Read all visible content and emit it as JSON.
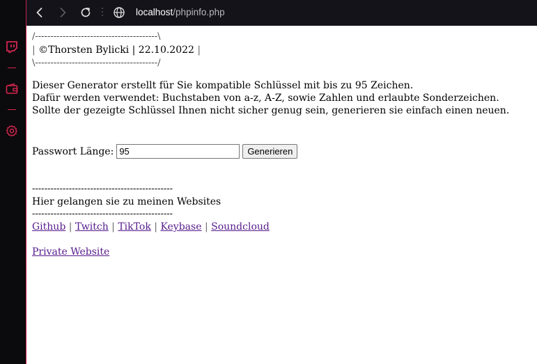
{
  "browser": {
    "url_host": "localhost",
    "url_path": "/phpinfo.php"
  },
  "sidebar": {
    "items": [
      {
        "icon": "twitch-icon"
      },
      {
        "icon": "wallet-icon"
      },
      {
        "icon": "settings-gear-icon"
      }
    ],
    "accent_color": "#d4264f"
  },
  "page": {
    "box_top": "/----------------------------------------\\",
    "box_text": "©Thorsten Bylicki | 22.10.2022",
    "box_bottom": "\\----------------------------------------/",
    "description_lines": [
      "Dieser Generator erstellt für Sie kompatible Schlüssel mit bis zu 95 Zeichen.",
      "Dafür werden verwendet: Buchstaben von a-z, A-Z, sowie Zahlen und erlaubte Sonderzeichen.",
      "Sollte der gezeigte Schlüssel Ihnen nicht sicher genug sein, generieren sie einfach einen neuen."
    ],
    "password_label": "Passwort Länge:",
    "password_length_value": "95",
    "generate_button": "Generieren",
    "divider": "----------------------------------------------",
    "links_heading": "Hier gelangen sie zu meinen Websites",
    "links": [
      "Github",
      "Twitch",
      "TikTok",
      "Keybase",
      "Soundcloud"
    ],
    "link_separator": "|",
    "private_link": "Private Website"
  }
}
